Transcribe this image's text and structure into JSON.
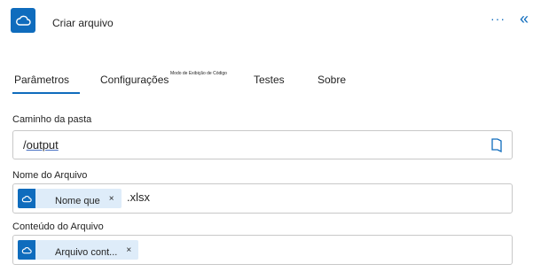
{
  "header": {
    "title": "Criar arquivo",
    "more_label": "···",
    "collapse_label": "«",
    "icon": "cloud-icon"
  },
  "tabs": {
    "parametros": "Parâmetros",
    "configuracoes": "Configurações",
    "code_view": "Modo de Exibição de Código",
    "testes": "Testes",
    "sobre": "Sobre"
  },
  "fields": {
    "folder_path": {
      "label": "Caminho da pasta",
      "value_prefix": "/",
      "value_underlined": "output",
      "icon": "folder-icon"
    },
    "file_name": {
      "label": "Nome do Arquivo",
      "token_label": "Nome que",
      "token_remove": "×",
      "suffix": ".xlsx"
    },
    "file_content": {
      "label": "Conteúdo do Arquivo",
      "token_label": "Arquivo cont...",
      "token_remove": "×"
    }
  },
  "colors": {
    "accent": "#0f6cbd",
    "token_bg": "#deecf9"
  }
}
